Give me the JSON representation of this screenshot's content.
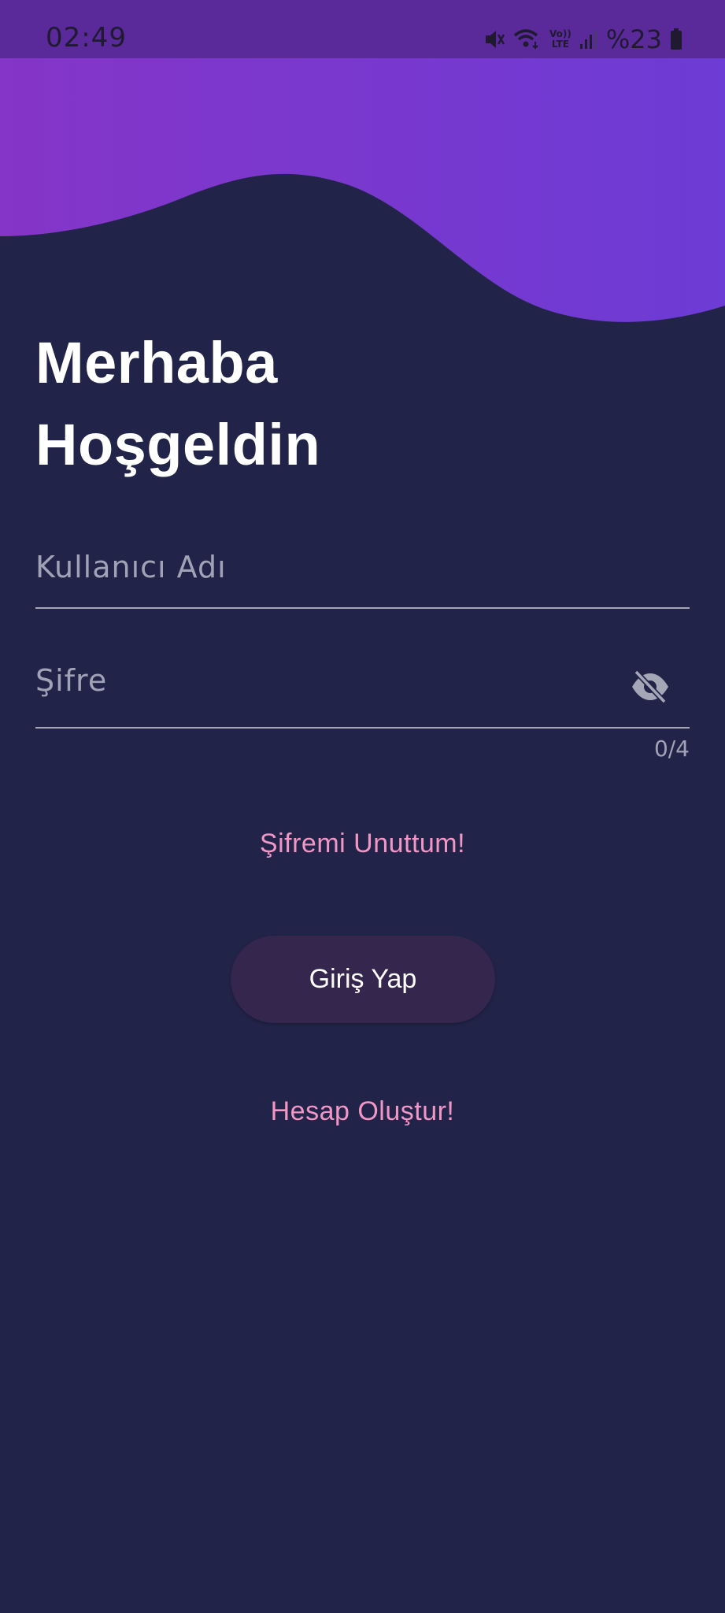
{
  "status_bar": {
    "time": "02:49",
    "battery": "%23",
    "icons": [
      "mute-icon",
      "wifi-icon",
      "volte-icon",
      "signal-icon",
      "battery-icon"
    ],
    "volte_label_top": "Vo))",
    "volte_label_bottom": "LTE"
  },
  "header": {
    "title_line_1": "Merhaba",
    "title_line_2": "Hoşgeldin"
  },
  "form": {
    "username_label": "Kullanıcı Adı",
    "password_label": "Şifre",
    "password_counter": "0/4",
    "password_visibility_icon": "eye-off-icon"
  },
  "actions": {
    "forgot_password": "Şifremi Unuttum!",
    "login_button": "Giriş Yap",
    "create_account": "Hesap Oluştur!"
  },
  "colors": {
    "background": "#212448",
    "header_gradient_start": "#8535c8",
    "header_gradient_end": "#6d3bd5",
    "status_bar": "#5a2a9a",
    "link": "#f097c5",
    "button": "#35264e",
    "text_primary": "#ffffff",
    "text_hint": "#a0a2b5"
  }
}
